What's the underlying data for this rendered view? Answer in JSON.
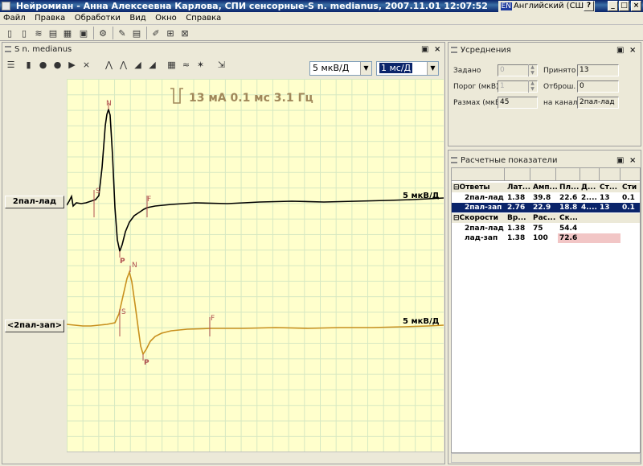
{
  "window": {
    "title": "Нейромиан - Анна Алексеевна Карлова, СПИ сенсорные-S n. medianus, 2007.11.01 12:07:52",
    "lang_code": "EN",
    "lang_label": "Английский (США)",
    "help": "?",
    "min": "_",
    "max": "□",
    "close": "×"
  },
  "menu": [
    "Файл",
    "Правка",
    "Обработки",
    "Вид",
    "Окно",
    "Справка"
  ],
  "left_panel": {
    "title": "S n. medianus",
    "close": "×",
    "pin": "▣",
    "sensitivity": "5 мкВ/Д",
    "sweep": "1 мс/Д",
    "stimulus": "13 мА  0.1 мс 3.1 Гц",
    "traces": [
      {
        "button": "2пал-лад",
        "scale": "5 мкВ/Д",
        "color": "#000000"
      },
      {
        "button": "<2пал-зап>",
        "scale": "5 мкВ/Д",
        "color": "#c8901e"
      }
    ],
    "markers": {
      "N": "N",
      "P": "P",
      "S": "S",
      "F": "F"
    }
  },
  "averaging": {
    "title": "Усреднения",
    "fields": [
      {
        "label": "Задано",
        "value": "0"
      },
      {
        "label": "Порог (мкВ)",
        "value": "1"
      },
      {
        "label": "Размах (мкВ)",
        "value": "45"
      }
    ],
    "right_fields": [
      {
        "label": "Принято",
        "value": "13"
      },
      {
        "label": "Отброш.",
        "value": "0"
      },
      {
        "label": "на канале",
        "value": "2пал-лад"
      }
    ]
  },
  "results": {
    "title": "Расчетные показатели",
    "groups": [
      {
        "name": "Ответы",
        "headers": [
          "Лат...",
          "Амп...",
          "Пл...",
          "Д...",
          "Ст...",
          "Сти"
        ],
        "rows": [
          {
            "name": "2пал-лад",
            "cells": [
              "1.38",
              "39.8",
              "22.6",
              "2....",
              "13",
              "0.1"
            ],
            "selected": false
          },
          {
            "name": "2пал-зап",
            "cells": [
              "2.76",
              "22.9",
              "18.8",
              "4....",
              "13",
              "0.1"
            ],
            "selected": true
          }
        ]
      },
      {
        "name": "Скорости",
        "headers": [
          "Вр...",
          "Рас...",
          "Ск..."
        ],
        "rows": [
          {
            "name": "2пал-лад",
            "cells": [
              "1.38",
              "75",
              "54.4"
            ],
            "highlight": false
          },
          {
            "name": "лад-зап",
            "cells": [
              "1.38",
              "100",
              "72.6"
            ],
            "highlight": true
          }
        ]
      }
    ]
  },
  "colors": {
    "plot_bg": "#ffffcc",
    "grid": "#d6e8c2",
    "selection": "#0a246a",
    "trace2": "#c8901e",
    "marker": "#b05050"
  }
}
